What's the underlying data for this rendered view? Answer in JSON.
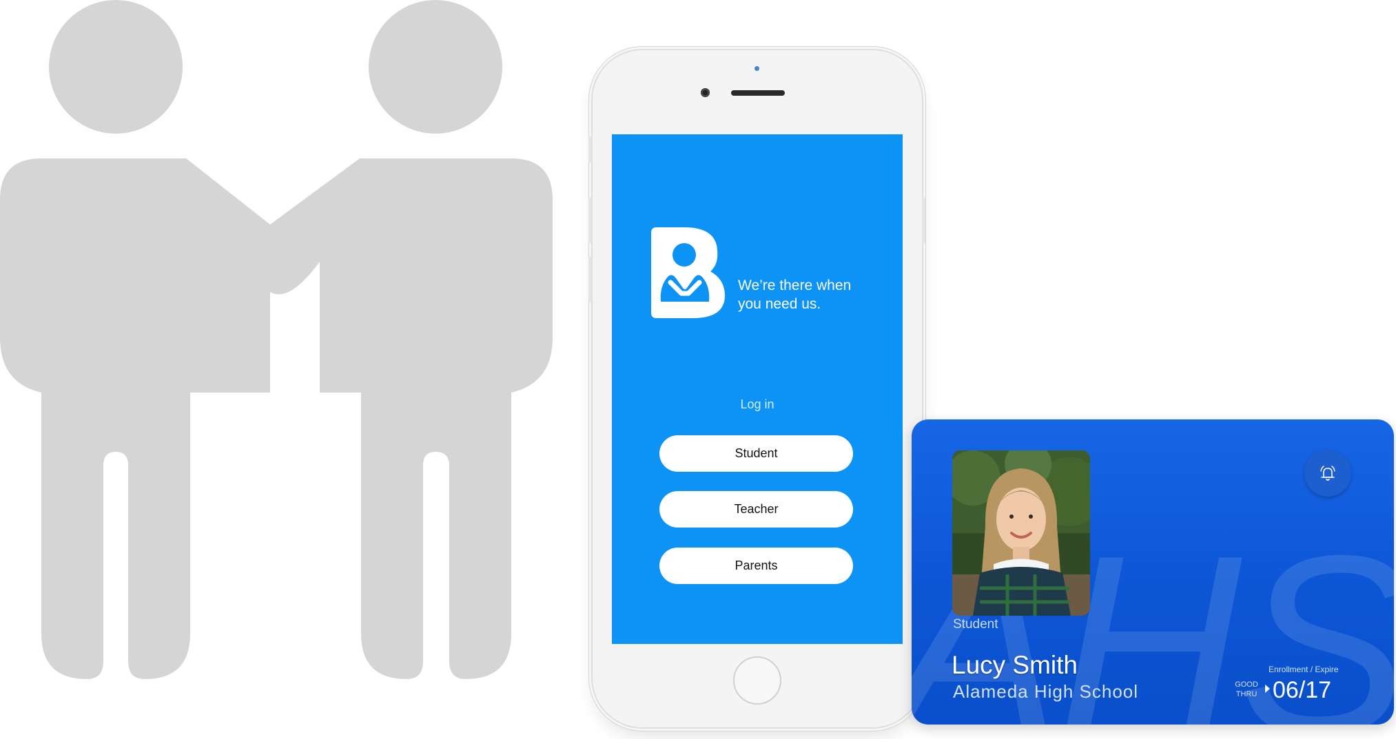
{
  "phone_screen": {
    "tagline": "We’re there when\nyou need us.",
    "login_label": "Log in",
    "buttons": {
      "student": "Student",
      "teacher": "Teacher",
      "parents": "Parents"
    },
    "screen_color": "#0d92f5"
  },
  "id_card": {
    "role": "Student",
    "name": "Lucy Smith",
    "school": "Alameda High School",
    "watermark": "AHS",
    "enrollment_label": "Enrollment / Expire",
    "good_thru": "GOOD\nTHRU",
    "expire": "06/17",
    "alert_icon": "alarm-bell-icon",
    "card_color": "#0c56d6"
  },
  "illustration": {
    "icon": "two-people-handshake-icon",
    "color": "#d6d5d6"
  }
}
